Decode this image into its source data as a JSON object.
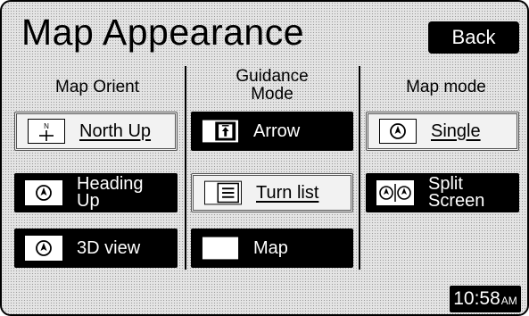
{
  "header": {
    "title": "Map Appearance",
    "back_label": "Back"
  },
  "columns": {
    "orient": {
      "header": "Map Orient",
      "buttons": [
        {
          "label": "North Up",
          "icon": "north-arrow-icon",
          "selected": true
        },
        {
          "label_line1": "Heading",
          "label_line2": "Up",
          "icon": "compass-icon",
          "selected": false
        },
        {
          "label": "3D view",
          "icon": "compass-icon",
          "selected": false
        }
      ]
    },
    "guidance": {
      "header_line1": "Guidance",
      "header_line2": "Mode",
      "buttons": [
        {
          "label": "Arrow",
          "icon": "arrow-icon",
          "selected": false
        },
        {
          "label": "Turn list",
          "icon": "list-icon",
          "selected": true
        },
        {
          "label": "Map",
          "icon": "map-icon",
          "selected": false
        }
      ]
    },
    "mode": {
      "header": "Map mode",
      "buttons": [
        {
          "label": "Single",
          "icon": "single-map-icon",
          "selected": true
        },
        {
          "label_line1": "Split",
          "label_line2": "Screen",
          "icon": "split-map-icon",
          "selected": false
        }
      ]
    }
  },
  "status": {
    "time": "10:58",
    "ampm": "AM"
  },
  "colors": {
    "background": "#e4e4e4",
    "button_dark": "#000000",
    "button_light": "#f2f2f2",
    "text_on_dark": "#ffffff"
  }
}
